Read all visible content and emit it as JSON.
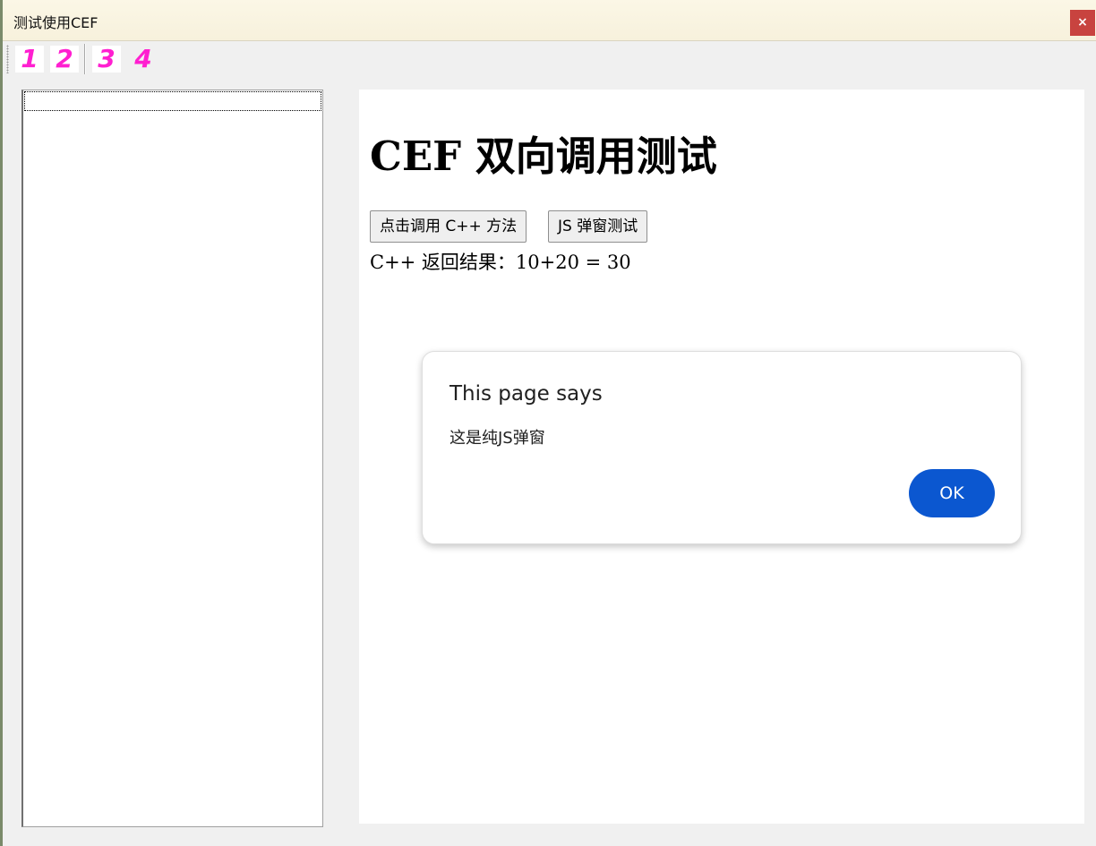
{
  "window": {
    "title": "测试使用CEF",
    "close_label": "×"
  },
  "toolbar": {
    "buttons": [
      {
        "label": "1"
      },
      {
        "label": "2"
      },
      {
        "label": "3"
      },
      {
        "label": "4"
      }
    ],
    "accent_color": "#ff1fd0"
  },
  "left_panel": {
    "items": [
      ""
    ]
  },
  "page": {
    "heading": "CEF 双向调用测试",
    "call_cpp_button": "点击调用 C++ 方法",
    "js_alert_button": "JS 弹窗测试",
    "result_text": "C++ 返回结果：10+20 = 30"
  },
  "dialog": {
    "title": "This page says",
    "message": "这是纯JS弹窗",
    "ok_label": "OK",
    "ok_color": "#0b57d0"
  }
}
